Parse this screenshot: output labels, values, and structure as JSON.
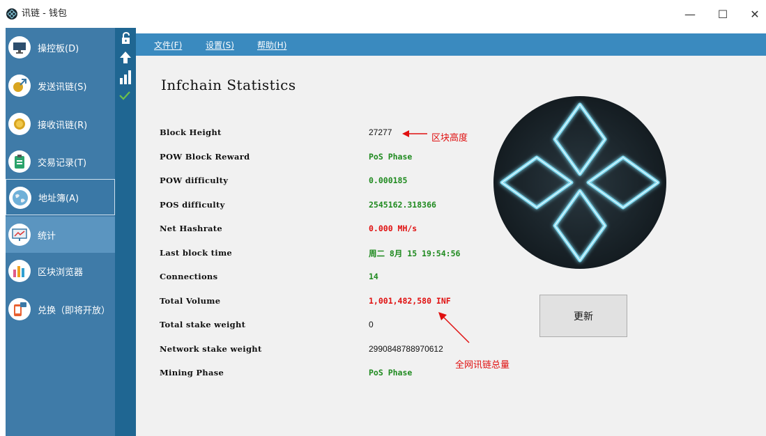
{
  "window": {
    "title": "讯链 - 钱包",
    "controls": {
      "minimize": "—",
      "maximize": "☐",
      "close": "✕"
    }
  },
  "sidebar": {
    "items": [
      {
        "label": "操控板(D)",
        "icon": "monitor-icon"
      },
      {
        "label": "发送讯链(S)",
        "icon": "send-coin-icon"
      },
      {
        "label": "接收讯链(R)",
        "icon": "receive-coin-icon"
      },
      {
        "label": "交易记录(T)",
        "icon": "clipboard-icon"
      },
      {
        "label": "地址簿(A)",
        "icon": "globe-icon"
      },
      {
        "label": "统计",
        "icon": "presentation-chart-icon"
      },
      {
        "label": "区块浏览器",
        "icon": "bar-chart-icon"
      },
      {
        "label": "兑换（即将开放）",
        "icon": "phone-chat-icon"
      }
    ]
  },
  "menu": {
    "file": "文件(F)",
    "settings": "设置(S)",
    "help": "帮助(H)"
  },
  "stats": {
    "title": "Infchain Statistics",
    "rows": [
      {
        "label": "Block Height",
        "value": "27277"
      },
      {
        "label": "POW Block Reward",
        "value": "PoS Phase"
      },
      {
        "label": "POW difficulty",
        "value": "0.000185"
      },
      {
        "label": "POS difficulty",
        "value": "2545162.318366"
      },
      {
        "label": "Net Hashrate",
        "value": "0.000 MH/s"
      },
      {
        "label": "Last block time",
        "value": "周二 8月 15 19:54:56"
      },
      {
        "label": "Connections",
        "value": "14"
      },
      {
        "label": "Total Volume",
        "value": "1,001,482,580 INF"
      },
      {
        "label": "Total stake weight",
        "value": "0"
      },
      {
        "label": "Network stake weight",
        "value": "2990848788970612"
      },
      {
        "label": "Mining Phase",
        "value": "PoS Phase"
      }
    ],
    "update_button": "更新"
  },
  "annotations": {
    "block_height_note": "区块高度",
    "total_volume_note": "全网讯链总量"
  },
  "colors": {
    "sidebar": "#3f7ba8",
    "status_strip": "#1f6692",
    "menubar": "#3a8abf",
    "green_value": "#1f8a1f",
    "red_value": "#e01010"
  }
}
